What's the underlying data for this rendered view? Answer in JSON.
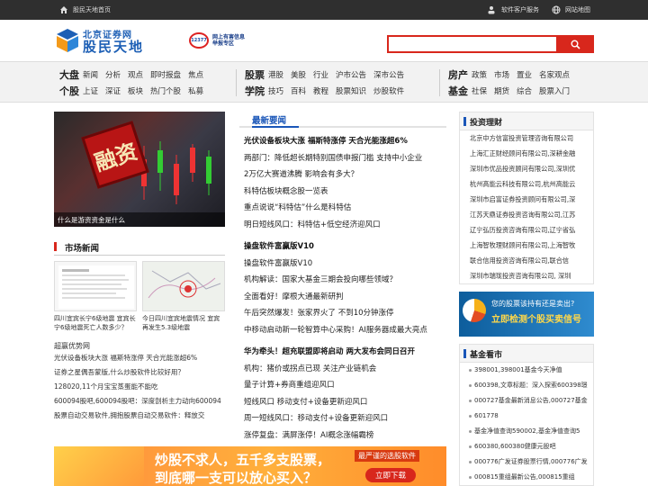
{
  "topbar": {
    "home": "股民天地首页",
    "service": "软件客户服务",
    "sitemap": "网站地图"
  },
  "logo": {
    "line1": "北京证券网",
    "line2": "股民天地"
  },
  "badge": {
    "circle": "12377",
    "line1": "网上有害信息",
    "line2": "举报专区"
  },
  "search": {
    "placeholder": ""
  },
  "nav": {
    "group1": [
      {
        "cat": "大盘",
        "links": [
          "新闻",
          "分析",
          "观点",
          "即时报盘",
          "焦点"
        ]
      },
      {
        "cat": "个股",
        "links": [
          "上证",
          "深证",
          "板块",
          "热门个股",
          "私募"
        ]
      }
    ],
    "group2": [
      {
        "cat": "股票",
        "links": [
          "港股",
          "美股",
          "行业",
          "沪市公告",
          "深市公告"
        ]
      },
      {
        "cat": "学院",
        "links": [
          "技巧",
          "百科",
          "教程",
          "股票知识",
          "炒股软件"
        ]
      }
    ],
    "group3": [
      {
        "cat": "房产",
        "links": [
          "政策",
          "市场",
          "置业",
          "名家观点"
        ]
      },
      {
        "cat": "基金",
        "links": [
          "社保",
          "期货",
          "综合",
          "股票入门"
        ]
      }
    ]
  },
  "hero": {
    "stamp": "融资",
    "caption": "什么是游资资金是什么"
  },
  "market": {
    "title": "市场新闻",
    "thumbs": [
      {
        "caption": "四川宜宾长宁6级地震 宜宾长宁6级地震死亡人数多少？"
      },
      {
        "caption": "今日四川宜宾地震情况 宜宾再发生5.3级地震"
      }
    ]
  },
  "links_left": {
    "title": "超赢优势网",
    "items": [
      "光伏设备板块大涨 福斯特涨停 天合光能涨超6%",
      "证券之星偶吾蒙版,什么炒股软件比较好用？",
      "128020,11个月宝宝蒸蛋能不能吃",
      "600094股吧,600094股吧：深度剖析主力动向600094",
      "股票自动交易软件,拥抱股票自动交易软件：释放交"
    ]
  },
  "news": {
    "title": "最新要闻",
    "items": [
      {
        "text": "光伏设备板块大涨 福斯特涨停 天合光能涨超6%",
        "bold": true
      },
      {
        "text": "两部门：降低超长期特别国债申报门槛 支持中小企业",
        "bold": false
      },
      {
        "text": "2万亿大赛道沸腾 影响会有多大？",
        "bold": false
      },
      {
        "text": "科特估板块概念股一览表",
        "bold": false
      },
      {
        "text": "重点说说“科特估”什么是科特估",
        "bold": false
      },
      {
        "text": "明日短线风口：科特估+低空经济迎风口",
        "bold": false
      },
      {
        "text": "",
        "gap": true
      },
      {
        "text": "操盘软件富赢版V10",
        "bold": true
      },
      {
        "text": "操盘软件富赢版V10",
        "bold": false
      },
      {
        "text": "机构解读：国家大基金三期会投向哪些领域？",
        "bold": false
      },
      {
        "text": "全面看好！摩根大通最新研判",
        "bold": false
      },
      {
        "text": "午后突然爆发！张家界火了 不到10分钟涨停",
        "bold": false
      },
      {
        "text": "中移动启动新一轮智算中心采购！AI服务器成最大亮点",
        "bold": false
      },
      {
        "text": "",
        "gap": true
      },
      {
        "text": "华为牵头！超充联盟即将启动 两大发布会同日召开",
        "bold": true
      },
      {
        "text": "机构：猪价或拐点已现 关注产业链机会",
        "bold": false
      },
      {
        "text": "量子计算+券商重组迎风口",
        "bold": false
      },
      {
        "text": "短线风口 移动支付+设备更新迎风口",
        "bold": false
      },
      {
        "text": "周一短线风口：移动支付+设备更新迎风口",
        "bold": false
      },
      {
        "text": "涨停复盘：满屏涨停！AI概念涨幅霸榜",
        "bold": false
      }
    ]
  },
  "invest": {
    "title": "投资理财",
    "items": [
      "北京中方信富投资管理咨询有限公司",
      "上海汇正财经顾问有限公司,深耕金融",
      "深圳市优品投资顾问有限公司,深圳优",
      "杭州高能云科技有限公司,杭州高能云",
      "深圳市启富证券投资顾问有限公司,深",
      "江苏天鼎证券投资咨询有限公司,江苏",
      "辽宁弘历投资咨询有限公司,辽宁省弘",
      "上海智牧理财顾问有限公司,上海智牧",
      "联合信用投资咨询有限公司,联合信",
      "深圳市瑞珑投资咨询有限公司, 深圳"
    ]
  },
  "promo": {
    "line1": "您的股票该持有还是卖出?",
    "line2": "立即检测个股买卖信号"
  },
  "fund": {
    "title": "基金看市",
    "items": [
      "398001,398001基金今天净值",
      "600398,文章标题：深入探索600398璟",
      "000727基金最新消息公告,000727基金",
      "601778",
      "基金净值查询590002,基金净值查询5",
      "600380,600380健康元股吧",
      "000776广发证券股票行情,000776广发",
      "000815重组最新公告,000815重组"
    ]
  },
  "banner": {
    "line1": "炒股不求人，五千多支股票，",
    "line2": "到底哪一支可以放心买入？",
    "tag": "最严谨的选股软件",
    "cta": "立即下载"
  },
  "colors": {
    "accent_red": "#d8271c",
    "brand_blue": "#1a56b8"
  }
}
